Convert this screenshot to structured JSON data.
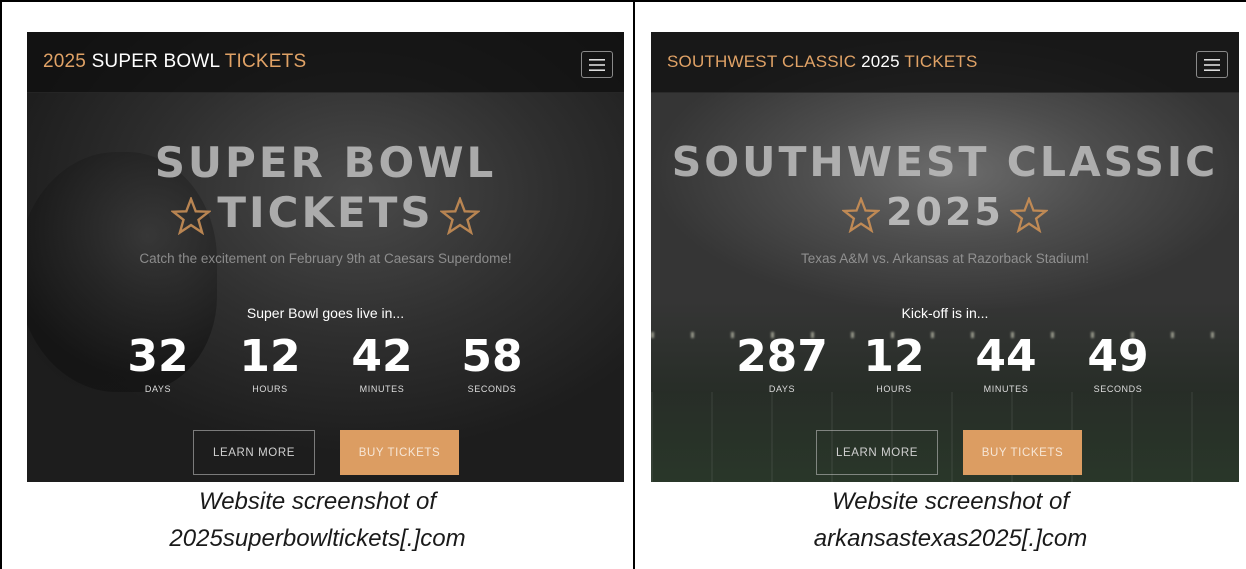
{
  "left": {
    "brand": {
      "part1": "2025",
      "part2": "SUPER BOWL",
      "part3": "TICKETS"
    },
    "hero": {
      "line1": "SUPER BOWL",
      "line2": "TICKETS"
    },
    "subtitle": "Catch the excitement on February 9th at Caesars Superdome!",
    "countdown_intro": "Super Bowl goes live in...",
    "countdown": [
      {
        "value": "32",
        "label": "DAYS"
      },
      {
        "value": "12",
        "label": "HOURS"
      },
      {
        "value": "42",
        "label": "MINUTES"
      },
      {
        "value": "58",
        "label": "SECONDS"
      }
    ],
    "buttons": {
      "learn_more": "LEARN MORE",
      "buy_tickets": "BUY TICKETS"
    },
    "caption": {
      "line1": "Website screenshot of",
      "line2": "2025superbowltickets[.]com"
    }
  },
  "right": {
    "brand": {
      "part1": "SOUTHWEST CLASSIC",
      "part2": "2025",
      "part3": "TICKETS"
    },
    "hero": {
      "line1": "SOUTHWEST CLASSIC",
      "line2": "2025"
    },
    "subtitle": "Texas A&M vs. Arkansas at Razorback Stadium!",
    "countdown_intro": "Kick-off is in...",
    "countdown": [
      {
        "value": "287",
        "label": "DAYS"
      },
      {
        "value": "12",
        "label": "HOURS"
      },
      {
        "value": "44",
        "label": "MINUTES"
      },
      {
        "value": "49",
        "label": "SECONDS"
      }
    ],
    "buttons": {
      "learn_more": "LEARN MORE",
      "buy_tickets": "BUY TICKETS"
    },
    "caption": {
      "line1": "Website screenshot of",
      "line2": "arkansastexas2025[.]com"
    }
  },
  "colors": {
    "accent": "#e0a266",
    "button_fill": "#dc9d62"
  },
  "icons": {
    "menu": "hamburger-menu-icon",
    "star": "star-outline-icon"
  }
}
